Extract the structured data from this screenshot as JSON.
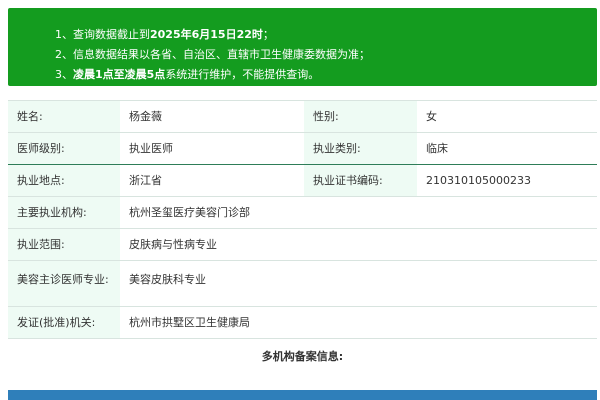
{
  "notice": {
    "line1_prefix": "1、查询数据截止到",
    "line1_date": "2025年6月15日22时",
    "line1_suffix": "；",
    "line2": "2、信息数据结果以各省、自治区、直辖市卫生健康委数据为准；",
    "line3_prefix": "3、",
    "line3_bold": "凌晨1点至凌晨5点",
    "line3_suffix": "系统进行维护，不能提供查询。"
  },
  "doctor": {
    "name_label": "姓名:",
    "name_value": "杨金薇",
    "gender_label": "性别:",
    "gender_value": "女",
    "level_label": "医师级别:",
    "level_value": "执业医师",
    "category_label": "执业类别:",
    "category_value": "临床",
    "location_label": "执业地点:",
    "location_value": "浙江省",
    "cert_label": "执业证书编码:",
    "cert_value": "210310105000233",
    "institution_label": "主要执业机构:",
    "institution_value": "杭州圣玺医疗美容门诊部",
    "scope_label": "执业范围:",
    "scope_value": "皮肤病与性病专业",
    "cosmetic_label": "美容主诊医师专业:",
    "cosmetic_value": "美容皮肤科专业",
    "authority_label": "发证(批准)机关:",
    "authority_value": "杭州市拱墅区卫生健康局"
  },
  "multi_title": "多机构备案信息:"
}
